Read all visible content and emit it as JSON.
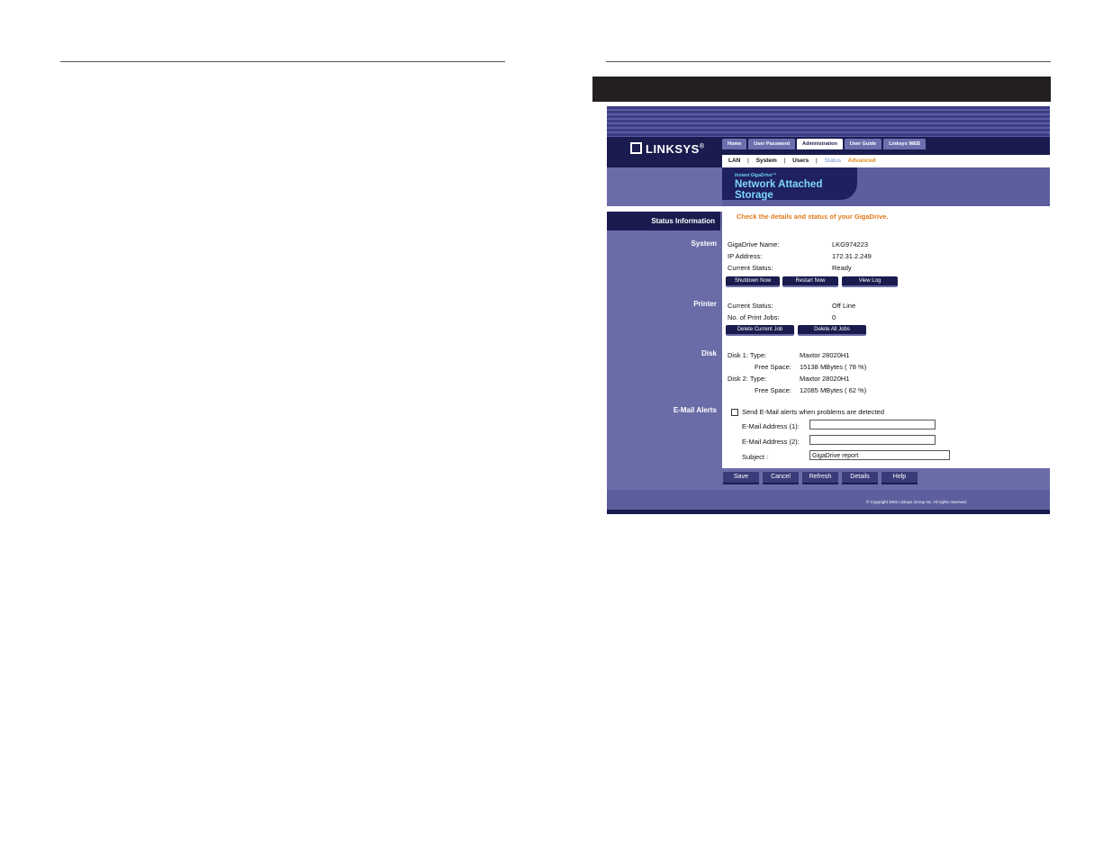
{
  "brand": {
    "logo_text": "LINKSYS",
    "registered": "®"
  },
  "tabs": [
    "Home",
    "User Password",
    "Administration",
    "User Guide",
    "Linksys WEB"
  ],
  "active_tab": "Administration",
  "subnav": {
    "lan": "LAN",
    "system": "System",
    "users": "Users",
    "status": "Status",
    "advanced": "Advanced",
    "separator": "|"
  },
  "banner": {
    "small": "Instant GigaDrive™",
    "title": "Network Attached Storage"
  },
  "sidebar": {
    "header": "Status Information",
    "system": "System",
    "printer": "Printer",
    "disk": "Disk",
    "email_alerts": "E-Mail Alerts"
  },
  "headline": "Check the details and status of your GigaDrive.",
  "system": {
    "name_label": "GigaDrive Name:",
    "name_value": "LKG974223",
    "ip_label": "IP Address:",
    "ip_value": "172.31.2.249",
    "status_label": "Current Status:",
    "status_value": "Ready",
    "buttons": {
      "shutdown": "Shutdown Now",
      "restart": "Restart Now",
      "viewlog": "View Log"
    }
  },
  "printer": {
    "status_label": "Current Status:",
    "status_value": "Off Line",
    "jobs_label": "No. of Print Jobs:",
    "jobs_value": "0",
    "buttons": {
      "delete_current": "Delete Current Job",
      "delete_all": "Delete All Jobs"
    }
  },
  "disk": {
    "disk1_label": "Disk 1: Type:",
    "disk1_type": "Maxtor 28020H1",
    "disk1_free_label": "Free Space:",
    "disk1_free": "15138 MBytes ( 78 %)",
    "disk2_label": "Disk 2: Type:",
    "disk2_type": "Maxtor 28020H1",
    "disk2_free_label": "Free Space:",
    "disk2_free": "12085 MBytes ( 62 %)"
  },
  "email": {
    "checkbox_label": "Send E-Mail alerts when problems are detected",
    "address1_label": "E-Mail Address (1):",
    "address1_value": "",
    "address2_label": "E-Mail Address (2):",
    "address2_value": "",
    "subject_label": "Subject :",
    "subject_value": "GigaDrive report"
  },
  "footer": {
    "save": "Save",
    "cancel": "Cancel",
    "refresh": "Refresh",
    "details": "Details",
    "help": "Help",
    "copyright": "© Copyright 2002 Linksys Group Inc. All rights reserved."
  },
  "colors": {
    "navy": "#1a1b4e",
    "lavender": "#6a6ca8",
    "orange": "#e27a1c",
    "cyan": "#7fd6ff"
  }
}
